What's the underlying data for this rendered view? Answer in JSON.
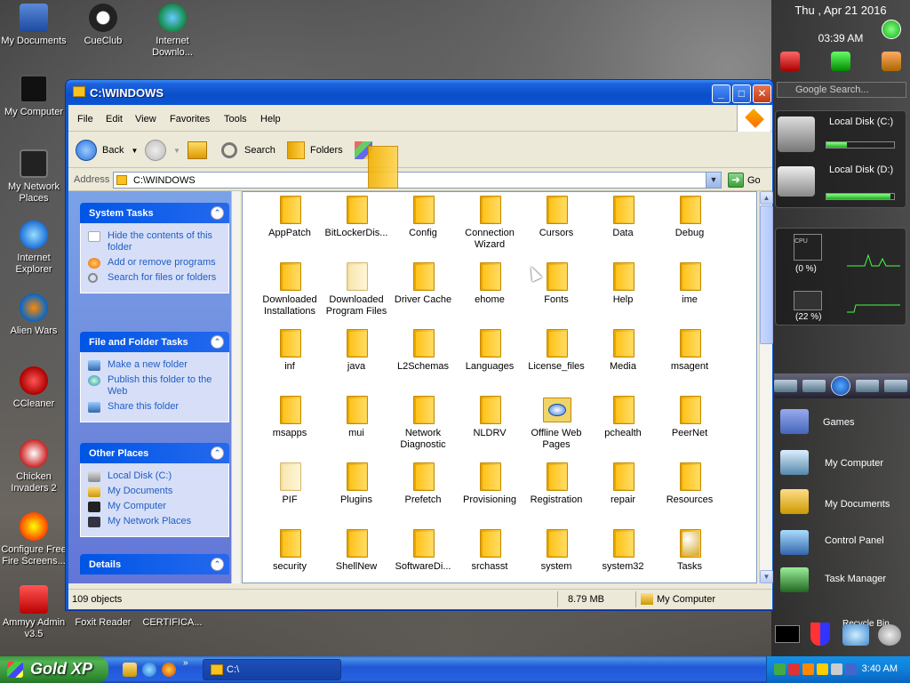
{
  "desktop": {
    "icons": [
      {
        "label": "My Documents"
      },
      {
        "label": "CueClub"
      },
      {
        "label": "Internet Downlo..."
      },
      {
        "label": "My Computer"
      },
      {
        "label": "My Network Places"
      },
      {
        "label": "Internet Explorer"
      },
      {
        "label": "Alien Wars"
      },
      {
        "label": "CCleaner"
      },
      {
        "label": "Chicken Invaders 2"
      },
      {
        "label": "Configure Free Fire Screens..."
      },
      {
        "label": "Ammyy Admin v3.5"
      },
      {
        "label": "Foxit Reader"
      },
      {
        "label": "CERTIFICA..."
      }
    ]
  },
  "sidebar": {
    "date": "Thu , Apr 21 2016",
    "time": "03:39 AM",
    "search_placeholder": "Google Search...",
    "disk_c": {
      "label": "Local Disk (C:)",
      "used_fraction": 0.3
    },
    "disk_d": {
      "label": "Local Disk (D:)",
      "used_fraction": 0.95
    },
    "cpu_label": "CPU",
    "cpu_percent": "(0 %)",
    "ram_percent": "(22 %)",
    "menu": [
      {
        "label": "Games"
      },
      {
        "label": "My Computer"
      },
      {
        "label": "My Documents"
      },
      {
        "label": "Control Panel"
      },
      {
        "label": "Task Manager"
      },
      {
        "label": "Recycle Bin"
      }
    ]
  },
  "window": {
    "title": "C:\\WINDOWS",
    "menu": [
      "File",
      "Edit",
      "View",
      "Favorites",
      "Tools",
      "Help"
    ],
    "toolbar": {
      "back": "Back",
      "search": "Search",
      "folders": "Folders"
    },
    "address": {
      "label": "Address",
      "value": "C:\\WINDOWS",
      "go": "Go"
    },
    "task_pane": {
      "system_tasks": {
        "title": "System Tasks",
        "links": [
          "Hide the contents of this folder",
          "Add or remove programs",
          "Search for files or folders"
        ]
      },
      "file_folder_tasks": {
        "title": "File and Folder Tasks",
        "links": [
          "Make a new folder",
          "Publish this folder to the Web",
          "Share this folder"
        ]
      },
      "other_places": {
        "title": "Other Places",
        "links": [
          "Local Disk (C:)",
          "My Documents",
          "My Computer",
          "My Network Places"
        ]
      },
      "details": {
        "title": "Details"
      }
    },
    "folders": [
      [
        "AppPatch",
        "BitLockerDis...",
        "Config",
        "Connection Wizard",
        "Cursors",
        "Data",
        "Debug"
      ],
      [
        "Downloaded Installations",
        "Downloaded Program Files",
        "Driver Cache",
        "ehome",
        "Fonts",
        "Help",
        "ime"
      ],
      [
        "inf",
        "java",
        "L2Schemas",
        "Languages",
        "License_files",
        "Media",
        "msagent"
      ],
      [
        "msapps",
        "mui",
        "Network Diagnostic",
        "NLDRV",
        "Offline Web Pages",
        "pchealth",
        "PeerNet"
      ],
      [
        "PIF",
        "Plugins",
        "Prefetch",
        "Provisioning",
        "Registration",
        "repair",
        "Resources"
      ],
      [
        "security",
        "ShellNew",
        "SoftwareDi...",
        "srchasst",
        "system",
        "system32",
        "Tasks"
      ]
    ],
    "status": {
      "objects": "109 objects",
      "size": "8.79 MB",
      "location": "My Computer"
    }
  },
  "taskbar": {
    "start_label": "Gold XP",
    "task_label": "C:\\",
    "clock": "3:40 AM"
  }
}
